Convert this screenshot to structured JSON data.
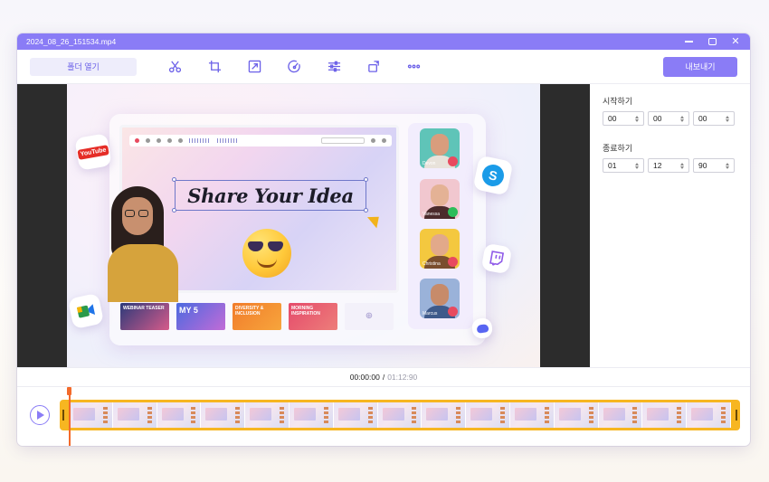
{
  "window": {
    "title": "2024_08_26_151534.mp4"
  },
  "toolbar": {
    "open_folder_label": "폴더 열기",
    "tools": [
      {
        "icon": "scissors-icon"
      },
      {
        "icon": "crop-icon"
      },
      {
        "icon": "resize-icon"
      },
      {
        "icon": "speed-icon"
      },
      {
        "icon": "adjust-icon"
      },
      {
        "icon": "rotate-icon"
      },
      {
        "icon": "more-icon"
      }
    ],
    "export_label": "내보내기"
  },
  "preview": {
    "headline": "Share Your Idea",
    "thumbnails": [
      "WEBINAR TEASER",
      "MY 5",
      "DIVERSITY & INCLUSION",
      "MORNING INSPIRATION"
    ],
    "participants": [
      "Devon",
      "Vanessa",
      "Christina",
      "Marcus"
    ],
    "apps": [
      "YouTube"
    ]
  },
  "settings": {
    "start_label": "시작하기",
    "start": [
      "00",
      "00",
      "00"
    ],
    "end_label": "종료하기",
    "end": [
      "01",
      "12",
      "90"
    ]
  },
  "timeline": {
    "current_time": "00:00:00",
    "separator": "/",
    "total_time": "01:12:90"
  },
  "colors": {
    "accent": "#8a7cf6",
    "trim_handle": "#f7b621",
    "playhead": "#f36a2b"
  }
}
